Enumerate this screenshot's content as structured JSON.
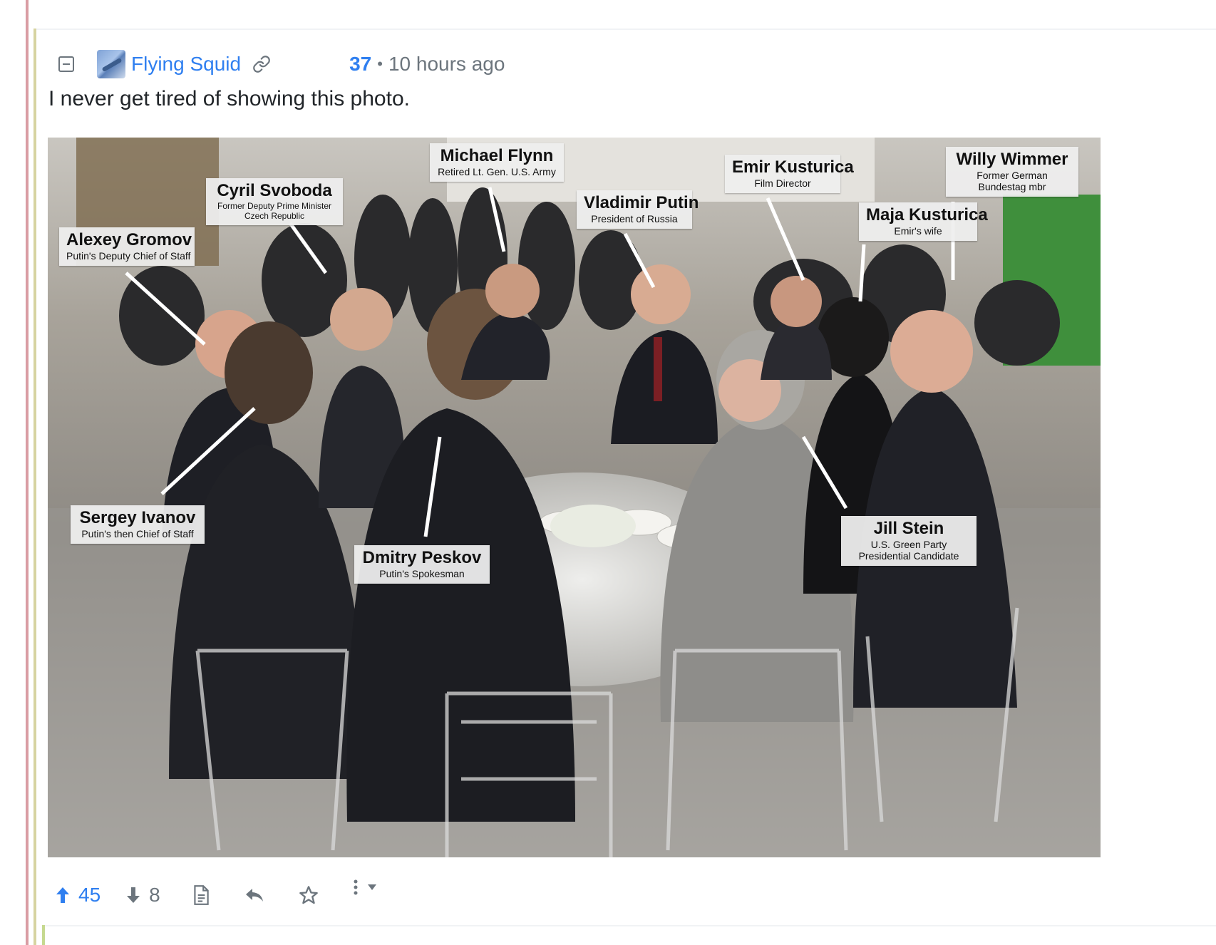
{
  "comment": {
    "author": "Flying Squid",
    "score": "37",
    "separator": "•",
    "time": "10 hours ago",
    "text": "I never get tired of showing this photo."
  },
  "photo": {
    "labels": [
      {
        "name": "Michael Flynn",
        "role": "Retired Lt. Gen. U.S. Army"
      },
      {
        "name": "Cyril Svoboda",
        "role": "Former Deputy Prime Minister",
        "role2": "Czech Republic"
      },
      {
        "name": "Alexey Gromov",
        "role": "Putin's Deputy Chief of Staff"
      },
      {
        "name": "Vladimir Putin",
        "role": "President of Russia"
      },
      {
        "name": "Emir Kusturica",
        "role": "Film Director"
      },
      {
        "name": "Willy Wimmer",
        "role": "Former German",
        "role2": "Bundestag mbr"
      },
      {
        "name": "Maja Kusturica",
        "role": "Emir's wife"
      },
      {
        "name": "Sergey Ivanov",
        "role": "Putin's then Chief of Staff"
      },
      {
        "name": "Dmitry Peskov",
        "role": "Putin's Spokesman"
      },
      {
        "name": "Jill Stein",
        "role": "U.S. Green Party",
        "role2": "Presidential Candidate"
      }
    ]
  },
  "actions": {
    "upvotes": "45",
    "downvotes": "8"
  },
  "colors": {
    "accent": "#2f7ff0",
    "muted": "#6c757d",
    "rail_outer": "#d99ca3",
    "rail_inner": "#d6d3a0",
    "rail_next": "#c6d98f"
  },
  "icons": {
    "collapse": "minus-square-icon",
    "permalink": "link-icon",
    "upvote": "arrow-up-icon",
    "downvote": "arrow-down-icon",
    "view_source": "document-icon",
    "reply": "reply-icon",
    "save": "star-icon",
    "more": "more-vertical-icon",
    "dropdown": "caret-down-icon"
  }
}
